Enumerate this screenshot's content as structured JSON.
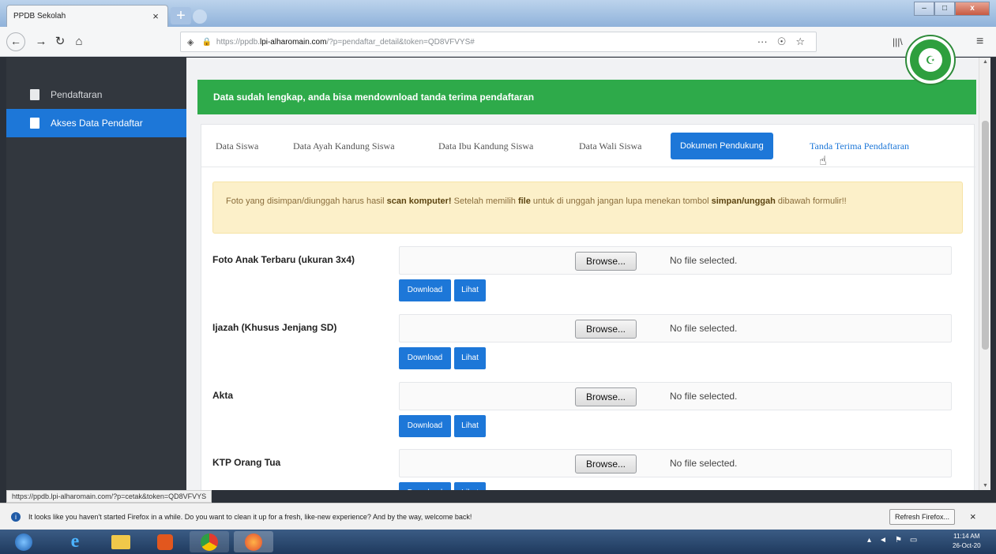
{
  "browser": {
    "tab_title": "PPDB Sekolah",
    "tab_close": "×",
    "new_tab": "+",
    "window_controls": {
      "minimize": "–",
      "maximize": "□",
      "close": "x"
    },
    "url_prefix": "https://ppdb.",
    "url_domain": "lpi-alharomain.com",
    "url_suffix": "/?p=pendaftar_detail&token=QD8VFVYS#",
    "url_more": "···",
    "status_url": "https://ppdb.lpi-alharomain.com/?p=cetak&token=QD8VFVYS"
  },
  "sidebar": {
    "items": [
      {
        "label": "Pendaftaran"
      },
      {
        "label": "Akses Data Pendaftar"
      }
    ]
  },
  "alerts": {
    "success": "Data sudah lengkap, anda bisa mendownload tanda terima pendaftaran",
    "warning_part1": "Foto yang disimpan/diunggah harus hasil ",
    "warning_bold1": "scan komputer!",
    "warning_part2": " Setelah memilih ",
    "warning_bold2": "file",
    "warning_part3": " untuk di unggah jangan lupa menekan tombol ",
    "warning_bold3": "simpan/unggah",
    "warning_part4": " dibawah formulir!!"
  },
  "tabs": [
    {
      "label": "Data Siswa"
    },
    {
      "label": "Data Ayah Kandung Siswa"
    },
    {
      "label": "Data Ibu Kandung Siswa"
    },
    {
      "label": "Data Wali Siswa"
    },
    {
      "label": "Dokumen Pendukung"
    },
    {
      "label": "Tanda Terima Pendaftaran"
    }
  ],
  "documents": [
    {
      "label": "Foto Anak Terbaru (ukuran 3x4)"
    },
    {
      "label": "Ijazah (Khusus Jenjang SD)"
    },
    {
      "label": "Akta"
    },
    {
      "label": "KTP Orang Tua"
    }
  ],
  "file_input": {
    "browse_label": "Browse...",
    "status": "No file selected."
  },
  "buttons": {
    "download": "Download",
    "lihat": "Lihat"
  },
  "notification": {
    "text": "It looks like you haven't started Firefox in a while. Do you want to clean it up for a fresh, like-new experience? And by the way, welcome back!",
    "refresh_label": "Refresh Firefox...",
    "close": "×"
  },
  "taskbar": {
    "time": "11:14 AM",
    "date": "26-Oct-20"
  }
}
